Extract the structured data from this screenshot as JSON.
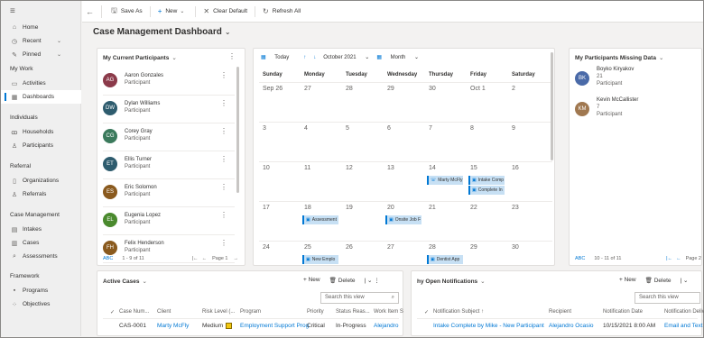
{
  "sidebar": {
    "menu_icon": "hamburger-icon",
    "top_items": [
      {
        "label": "Home",
        "icon": "⌂"
      },
      {
        "label": "Recent",
        "icon": "◷",
        "chev": "⌄"
      },
      {
        "label": "Pinned",
        "icon": "✎",
        "chev": "⌄"
      }
    ],
    "my_work_header": "My Work",
    "my_work": [
      {
        "label": "Activities",
        "icon": "▭"
      },
      {
        "label": "Dashboards",
        "icon": "▦"
      }
    ],
    "individuals_header": "Individuals",
    "individuals": [
      {
        "label": "Households",
        "icon": "ꝏ"
      },
      {
        "label": "Participants",
        "icon": "♙"
      }
    ],
    "referral_header": "Referral",
    "referral": [
      {
        "label": "Organizations",
        "icon": "▯"
      },
      {
        "label": "Referrals",
        "icon": "♙"
      }
    ],
    "case_header": "Case Management",
    "case": [
      {
        "label": "Intakes",
        "icon": "▤"
      },
      {
        "label": "Cases",
        "icon": "▥"
      },
      {
        "label": "Assessments",
        "icon": "⌕"
      }
    ],
    "framework_header": "Framework",
    "framework": [
      {
        "label": "Programs",
        "icon": "▪"
      },
      {
        "label": "Objectives",
        "icon": "⁘"
      }
    ]
  },
  "toolbar": {
    "back": "←",
    "save_as": "Save As",
    "new": "New",
    "clear_default": "Clear Default",
    "refresh_all": "Refresh All"
  },
  "page_title": "Case Management Dashboard",
  "participants": {
    "title": "My Current Participants",
    "items": [
      {
        "initials": "AG",
        "name": "Aaron Gonzales",
        "role": "Participant",
        "color": "#8b3a4a"
      },
      {
        "initials": "DW",
        "name": "Dylan Williams",
        "role": "Participant",
        "color": "#2e5c6e"
      },
      {
        "initials": "CG",
        "name": "Corey Gray",
        "role": "Participant",
        "color": "#3b7a5c"
      },
      {
        "initials": "ET",
        "name": "Ellis Turner",
        "role": "Participant",
        "color": "#2e5c6e"
      },
      {
        "initials": "ES",
        "name": "Eric Solomon",
        "role": "Participant",
        "color": "#8a5a1e"
      },
      {
        "initials": "EL",
        "name": "Eugenia Lopez",
        "role": "Participant",
        "color": "#4a8a2e"
      },
      {
        "initials": "FH",
        "name": "Felix Henderson",
        "role": "Participant",
        "color": "#8a5a1e"
      }
    ],
    "pager": {
      "abc": "ABC",
      "range": "1 - 9 of 11",
      "page": "Page 1"
    }
  },
  "calendar": {
    "today": "Today",
    "month": "October 2021",
    "view": "Month",
    "days": [
      "Sunday",
      "Monday",
      "Tuesday",
      "Wednesday",
      "Thursday",
      "Friday",
      "Saturday"
    ],
    "weeks": [
      [
        "Sep 26",
        "27",
        "28",
        "29",
        "30",
        "Oct 1",
        "2"
      ],
      [
        "3",
        "4",
        "5",
        "6",
        "7",
        "8",
        "9"
      ],
      [
        "10",
        "11",
        "12",
        "13",
        "14",
        "15",
        "16"
      ],
      [
        "17",
        "18",
        "19",
        "20",
        "21",
        "22",
        "23"
      ],
      [
        "24",
        "25",
        "26",
        "27",
        "28",
        "29",
        "30"
      ]
    ],
    "events": [
      {
        "label": "Marty McFly",
        "week": 2,
        "day": 4,
        "slot": 0,
        "icon": "☏"
      },
      {
        "label": "Intake Comp",
        "week": 2,
        "day": 5,
        "slot": 0,
        "icon": "▣"
      },
      {
        "label": "Complete In",
        "week": 2,
        "day": 5,
        "slot": 1,
        "icon": "▣"
      },
      {
        "label": "Assessment",
        "week": 3,
        "day": 1,
        "slot": 0,
        "icon": "▣"
      },
      {
        "label": "Onsite Job F",
        "week": 3,
        "day": 3,
        "slot": 0,
        "icon": "▣"
      },
      {
        "label": "New Emplo",
        "week": 4,
        "day": 1,
        "slot": 0,
        "icon": "▣"
      },
      {
        "label": "Dentist App",
        "week": 4,
        "day": 4,
        "slot": 0,
        "icon": "▣"
      }
    ]
  },
  "missing": {
    "title": "My Participants Missing Data",
    "items": [
      {
        "initials": "BK",
        "name": "Boyko Kiryakov",
        "line1": "21",
        "line2": "Participant",
        "color": "#4a6aa8"
      },
      {
        "initials": "KM",
        "name": "Kevin McCallister",
        "line1": "7",
        "line2": "Participant",
        "color": "#a07850"
      }
    ],
    "pager": {
      "abc": "ABC",
      "range": "10 - 11 of 11",
      "page": "Page 2"
    }
  },
  "active_cases": {
    "title": "Active Cases",
    "new": "New",
    "delete": "Delete",
    "search_placeholder": "Search this view",
    "columns": [
      "Case Num...",
      "Client",
      "Risk Level (...",
      "Program",
      "Priority",
      "Status Reas...",
      "Work Item S"
    ],
    "rows": [
      [
        "CAS-0001",
        "Marty McFly",
        "Medium",
        "Employment Support Prog",
        "Critical",
        "In-Progress",
        "Alejandro"
      ]
    ]
  },
  "notifications": {
    "title": "hy Open Notifications",
    "new": "New",
    "delete": "Delete",
    "search_placeholder": "Search this view",
    "columns": [
      "Notification Subject ↑",
      "Recipient",
      "Notification Date",
      "Notification Deliv"
    ],
    "rows": [
      [
        "Intake Complete by Mike - New Participant",
        "Alejandro Ocasio",
        "10/15/2021 8:00 AM",
        "Email and Text"
      ]
    ]
  }
}
